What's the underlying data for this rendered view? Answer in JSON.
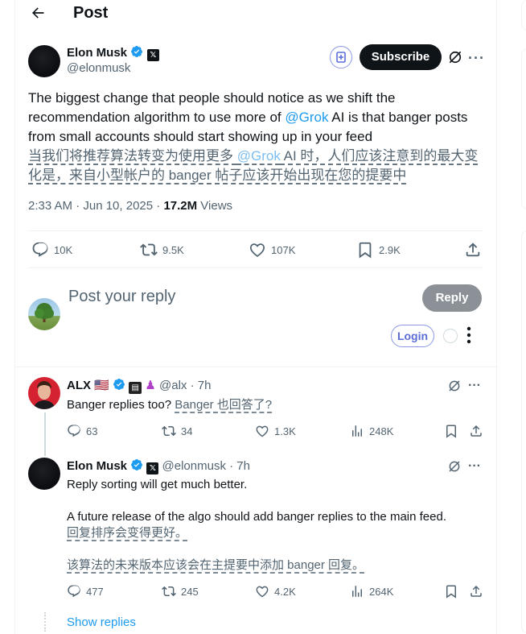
{
  "header": {
    "title": "Post"
  },
  "post": {
    "author_name": "Elon Musk",
    "author_handle": "@elonmusk",
    "subscribe_label": "Subscribe",
    "text_part1": "The biggest change that people should notice as we shift the recommendation algorithm to use more of ",
    "mention": "@Grok",
    "text_part2": " AI is that banger posts from small accounts should start showing up in your feed",
    "trans_part1": "当我们将推荐算法转变为使用更多 ",
    "trans_mention": "@Grok",
    "trans_part2": " AI 时，人们应该注意到的最大变化是，来自小型帐户的 banger 帖子应该开始出现在您的提要中",
    "time": "2:33 AM · Jun 10, 2025 · ",
    "views_count": "17.2M",
    "views_label": " Views",
    "replies": "10K",
    "reposts": "9.5K",
    "likes": "107K",
    "bookmarks": "2.9K"
  },
  "composer": {
    "placeholder": "Post your reply",
    "reply_label": "Reply",
    "login_label": "Login"
  },
  "replies": [
    {
      "author_name": "ALX",
      "flag": "🇺🇸",
      "author_handle": "@alx",
      "time": "· 7h",
      "text": "Banger replies too?",
      "translation": "Banger 也回答了?",
      "replies": "63",
      "reposts": "34",
      "likes": "1.3K",
      "views": "248K"
    },
    {
      "author_name": "Elon Musk",
      "author_handle": "@elonmusk",
      "time": "· 7h",
      "text1": "Reply sorting will get much better.",
      "text2": "A future release of the algo should add banger replies to the main feed.",
      "translation1": "回复排序会变得更好。",
      "translation2": "该算法的未来版本应该会在主提要中添加 banger 回复。",
      "replies": "477",
      "reposts": "245",
      "likes": "4.2K",
      "views": "264K"
    }
  ],
  "show_replies_label": "Show replies",
  "colors": {
    "accent": "#1d9bf0",
    "text": "#0f1419",
    "muted": "#536471"
  },
  "icons": [
    "back-arrow-icon",
    "verified-icon",
    "x-badge-icon",
    "premium-icon",
    "grok-icon",
    "more-icon",
    "reply-icon",
    "repost-icon",
    "like-icon",
    "bookmark-icon",
    "share-icon",
    "views-icon"
  ]
}
